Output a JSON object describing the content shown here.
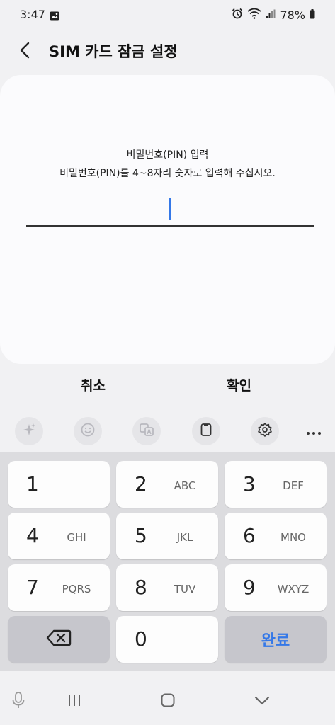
{
  "status_bar": {
    "time": "3:47",
    "battery_percent": "78%",
    "icons": [
      "gallery-icon",
      "alarm-icon",
      "wifi-icon",
      "signal-icon",
      "battery-icon"
    ]
  },
  "header": {
    "back_icon": "back-arrow-icon",
    "title": "SIM 카드 잠금 설정"
  },
  "pin_dialog": {
    "prompt_title": "비밀번호(PIN) 입력",
    "prompt_hint": "비밀번호(PIN)를 4~8자리 숫자로 입력해 주십시오.",
    "input_value": "",
    "accent_color": "#3478e8"
  },
  "actions": {
    "cancel_label": "취소",
    "ok_label": "확인"
  },
  "keyboard_toolbar": {
    "items": [
      "sparkle-icon",
      "emoji-icon",
      "translate-icon",
      "clipboard-icon",
      "settings-icon",
      "more-icon"
    ]
  },
  "keypad": {
    "rows": [
      [
        {
          "num": "1",
          "sub": ""
        },
        {
          "num": "2",
          "sub": "ABC"
        },
        {
          "num": "3",
          "sub": "DEF"
        }
      ],
      [
        {
          "num": "4",
          "sub": "GHI"
        },
        {
          "num": "5",
          "sub": "JKL"
        },
        {
          "num": "6",
          "sub": "MNO"
        }
      ],
      [
        {
          "num": "7",
          "sub": "PQRS"
        },
        {
          "num": "8",
          "sub": "TUV"
        },
        {
          "num": "9",
          "sub": "WXYZ"
        }
      ]
    ],
    "backspace_icon": "backspace-icon",
    "zero": "0",
    "done_label": "완료"
  },
  "nav_bar": {
    "items": [
      "mic-icon",
      "recent-apps-icon",
      "home-icon",
      "hide-keyboard-icon"
    ]
  }
}
